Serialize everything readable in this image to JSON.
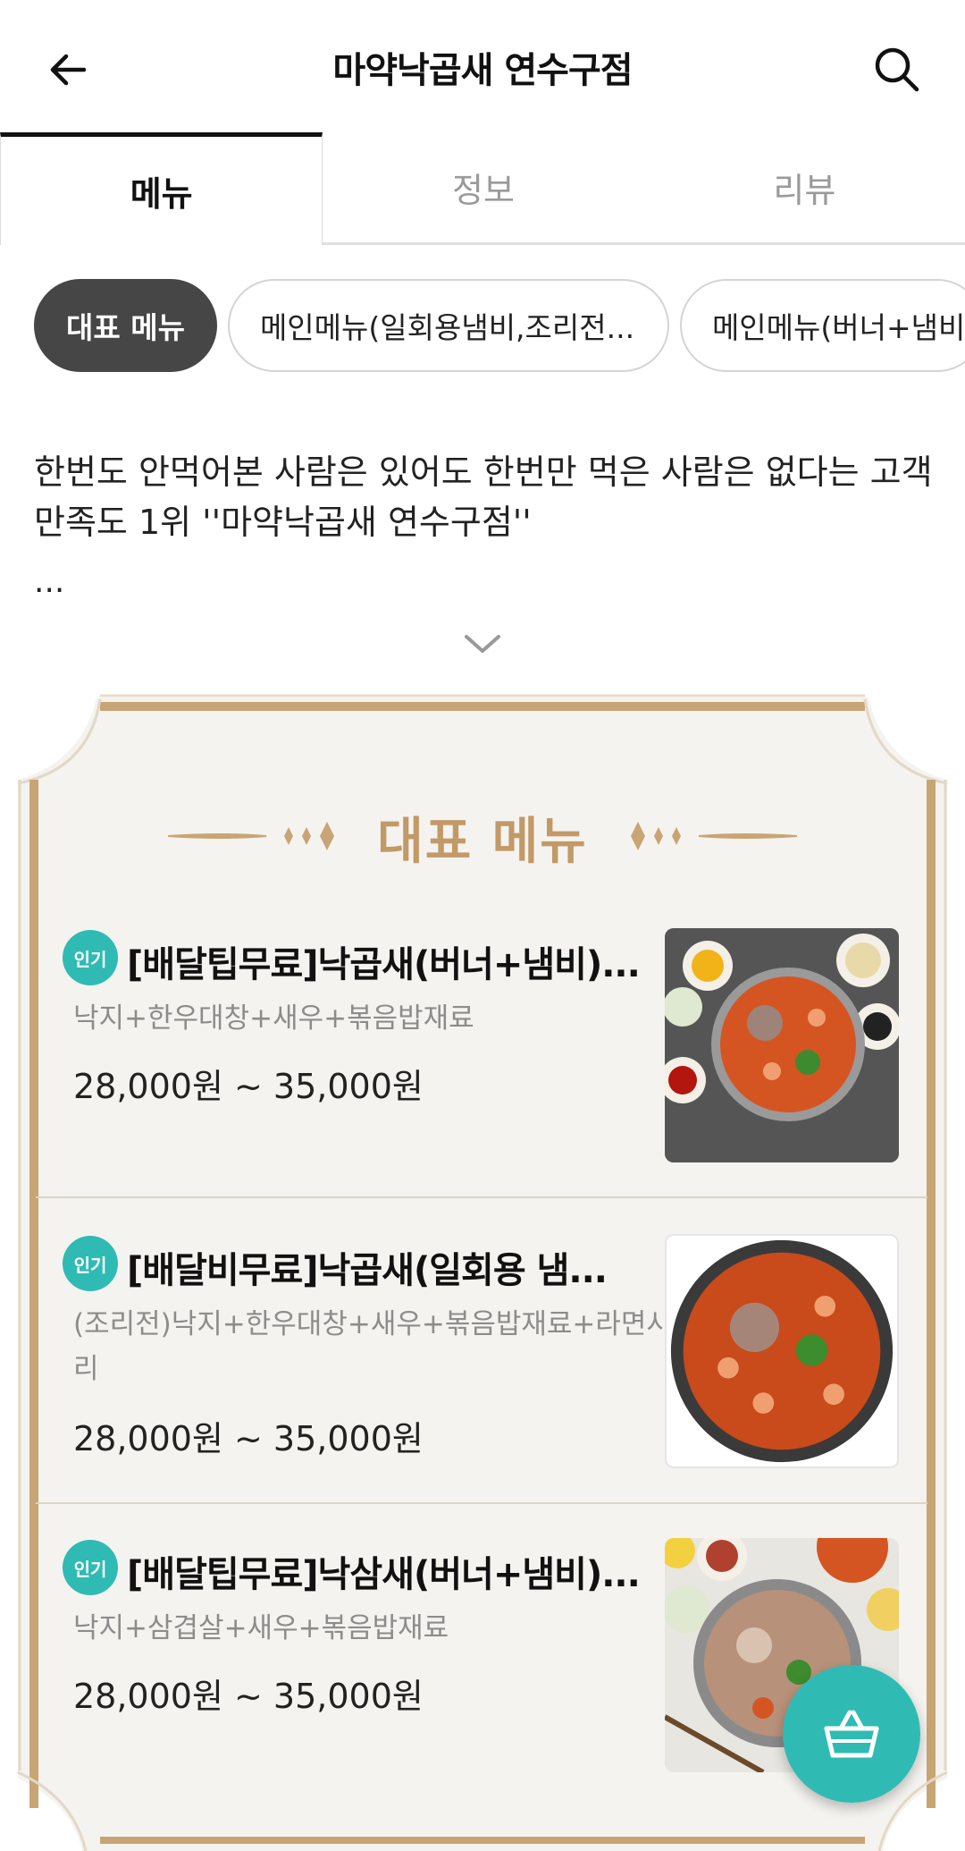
{
  "header": {
    "title": "마약낙곱새 연수구점"
  },
  "tabs": [
    {
      "label": "메뉴",
      "active": true
    },
    {
      "label": "정보",
      "active": false
    },
    {
      "label": "리뷰",
      "active": false
    }
  ],
  "chips": [
    {
      "label": "대표 메뉴",
      "active": true
    },
    {
      "label": "메인메뉴(일회용냄비,조리전...",
      "active": false
    },
    {
      "label": "메인메뉴(버너+냄비)",
      "active": false
    }
  ],
  "description": {
    "text": "한번도 안먹어본 사람은 있어도 한번만 먹은 사람은 없다는 고객만족도 1위 ''마약낙곱새 연수구점''",
    "more": "..."
  },
  "rep_menu": {
    "title": "대표 메뉴",
    "items": [
      {
        "badge": "인기",
        "name": "[배달팁무료]낙곱새(버너+냄비)...",
        "desc": "낙지+한우대창+새우+볶음밥재료",
        "price": "28,000원 ~ 35,000원"
      },
      {
        "badge": "인기",
        "name": "[배달비무료]낙곱새(일회용 냄...",
        "desc": "(조리전)낙지+한우대창+새우+볶음밥재료+라면사리",
        "price": "28,000원 ~ 35,000원"
      },
      {
        "badge": "인기",
        "name": "[배달팁무료]낙삼새(버너+냄비)...",
        "desc": "낙지+삼겹살+새우+볶음밥재료",
        "price": "28,000원 ~ 35,000원"
      }
    ]
  },
  "colors": {
    "accent": "#2fbbb4",
    "gold": "#c19a68",
    "chip_active": "#464646"
  },
  "icons": {
    "back": "arrow-left-icon",
    "search": "search-icon",
    "expand": "chevron-down-icon",
    "cart": "shopping-basket-icon"
  }
}
